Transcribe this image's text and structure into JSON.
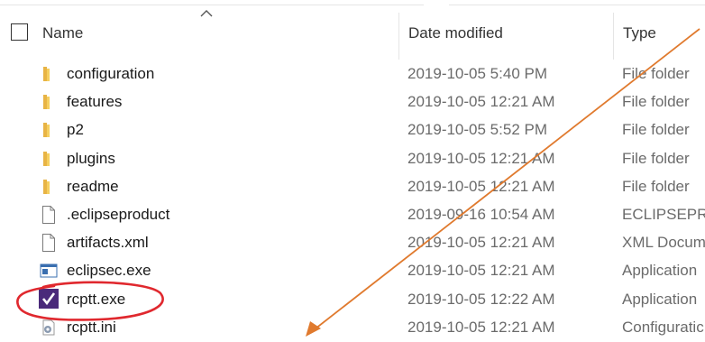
{
  "columns": {
    "name": "Name",
    "date": "Date modified",
    "type": "Type"
  },
  "files": [
    {
      "name": "configuration",
      "date": "2019-10-05 5:40 PM",
      "type": "File folder",
      "icon": "folder-icon"
    },
    {
      "name": "features",
      "date": "2019-10-05 12:21 AM",
      "type": "File folder",
      "icon": "folder-icon"
    },
    {
      "name": "p2",
      "date": "2019-10-05 5:52 PM",
      "type": "File folder",
      "icon": "folder-icon"
    },
    {
      "name": "plugins",
      "date": "2019-10-05 12:21 AM",
      "type": "File folder",
      "icon": "folder-icon"
    },
    {
      "name": "readme",
      "date": "2019-10-05 12:21 AM",
      "type": "File folder",
      "icon": "folder-icon"
    },
    {
      "name": ".eclipseproduct",
      "date": "2019-09-16 10:54 AM",
      "type": "ECLIPSEPRC",
      "icon": "file-icon"
    },
    {
      "name": "artifacts.xml",
      "date": "2019-10-05 12:21 AM",
      "type": "XML Docum",
      "icon": "file-icon"
    },
    {
      "name": "eclipsec.exe",
      "date": "2019-10-05 12:21 AM",
      "type": "Application",
      "icon": "console-app-icon"
    },
    {
      "name": "rcptt.exe",
      "date": "2019-10-05 12:22 AM",
      "type": "Application",
      "icon": "rcptt-app-icon"
    },
    {
      "name": "rcptt.ini",
      "date": "2019-10-05 12:21 AM",
      "type": "Configuratic",
      "icon": "config-settings-icon"
    }
  ],
  "annotation": {
    "highlight_color": "#e0282e",
    "arrow_color": "#e07a2e",
    "highlighted_file": "rcptt.exe"
  }
}
